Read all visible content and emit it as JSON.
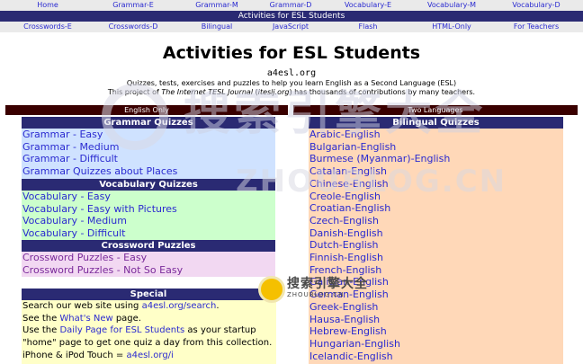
{
  "top_nav": [
    "Home",
    "Grammar-E",
    "Grammar-M",
    "Grammar-D",
    "Vocabulary-E",
    "Vocabulary-M",
    "Vocabulary-D"
  ],
  "title_bar": "Activities for ESL Students",
  "sub_nav": [
    "Crosswords-E",
    "Crosswords-D",
    "Bilingual",
    "JavaScript",
    "Flash",
    "HTML-Only",
    "For Teachers"
  ],
  "header": {
    "title": "Activities for ESL Students",
    "domain": "a4esl.org",
    "intro1": "Quizzes, tests, exercises and puzzles to help you learn English as a Second Language (ESL)",
    "intro2_before": "This project of ",
    "intro2_journal": "The Internet TESL Journal",
    "intro2_mid": " (",
    "intro2_site": "iteslj.org",
    "intro2_after": ") has thousands of contributions by many teachers."
  },
  "left": {
    "column_head": "English Only",
    "grammar": {
      "title": "Grammar Quizzes",
      "items": [
        "Grammar - Easy",
        "Grammar - Medium",
        "Grammar - Difficult",
        "Grammar Quizzes about Places"
      ]
    },
    "vocabulary": {
      "title": "Vocabulary Quizzes",
      "items": [
        "Vocabulary - Easy",
        "Vocabulary - Easy with Pictures",
        "Vocabulary - Medium",
        "Vocabulary - Difficult"
      ]
    },
    "crossword": {
      "title": "Crossword Puzzles",
      "items": [
        "Crossword Puzzles - Easy",
        "Crossword Puzzles - Not So Easy"
      ]
    },
    "special": {
      "title": "Special",
      "line1_before": "Search our web site using ",
      "line1_link": "a4esl.org/search",
      "line1_after": ".",
      "line2_before": "See the ",
      "line2_link": "What's New",
      "line2_after": " page.",
      "line3_before": "Use the ",
      "line3_link": "Daily Page for ESL Students",
      "line3_after": " as your startup",
      "line4": "\"home\" page to get one quiz a day from this collection.",
      "line5_before": "iPhone & iPod Touch = ",
      "line5_link": "a4esl.org/i"
    }
  },
  "right": {
    "column_head": "Two Languages",
    "bilingual": {
      "title": "Bilingual Quizzes",
      "items": [
        "Arabic-English",
        "Bulgarian-English",
        "Burmese (Myanmar)-English",
        "Catalan-English",
        "Chinese-English",
        "Creole-English",
        "Croatian-English",
        "Czech-English",
        "Danish-English",
        "Dutch-English",
        "Finnish-English",
        "French-English",
        "Galician-English",
        "German-English",
        "Greek-English",
        "Hausa-English",
        "Hebrew-English",
        "Hungarian-English",
        "Icelandic-English"
      ]
    }
  },
  "watermark": {
    "cn_text": "搜索引擎大全",
    "en_text": "ZHOUBLOG.CN",
    "small_cn": "搜索引擎大全",
    "small_en": "ZHOUBLOG.CN"
  },
  "colors": {
    "nav_bg": "#eaeaea",
    "title_bar_bg": "#2a2a73",
    "col_head_bg": "#3a0000",
    "grammar_bg": "#cfe2ff",
    "vocabulary_bg": "#ccffcc",
    "crossword_bg": "#f2d8f2",
    "special_bg": "#ffffc8",
    "bilingual_bg": "#ffd8b8",
    "link": "#2a2ad0",
    "purple_link": "#7a2a9a"
  }
}
